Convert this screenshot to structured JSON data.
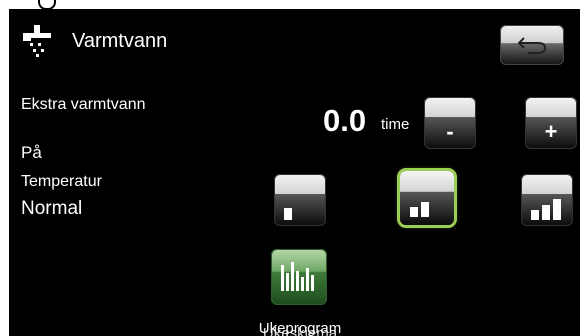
{
  "header": {
    "title": "Varmtvann",
    "icon": "shower-faucet-icon",
    "back_icon": "back-arrow-icon"
  },
  "extra_hot_water": {
    "label": "Ekstra varmtvann",
    "status": "På",
    "value": "0.0",
    "unit": "time"
  },
  "temperature": {
    "label": "Temperatur",
    "value": "Normal",
    "selected_level": 2,
    "levels": 3
  },
  "weekly": {
    "label_primary": "Ukeskjema",
    "label_overlay": "Ukeprogram",
    "icon": "bar-chart-icon"
  },
  "buttons": {
    "minus": "-",
    "plus": "+"
  },
  "colors": {
    "selected_outline": "#9ccd55",
    "schedule_green": "#4e8b46"
  }
}
